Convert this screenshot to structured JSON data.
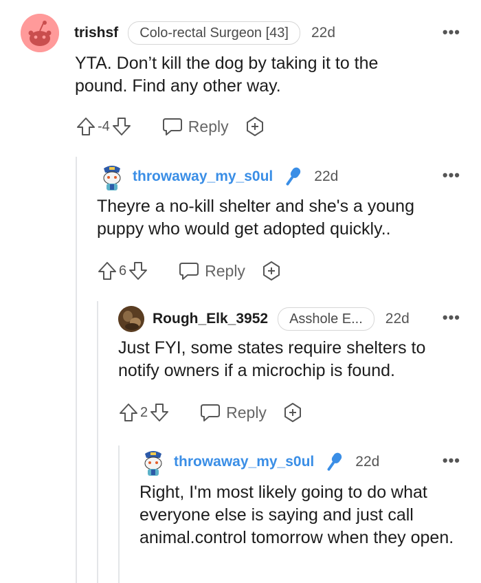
{
  "comments": [
    {
      "author": "trishsf",
      "flair": "Colo-rectal Surgeon [43]",
      "age": "22d",
      "more": "•••",
      "body": "YTA. Don’t kill the dog by taking it to the pound. Find any other way.",
      "score": "-4",
      "reply_label": "Reply",
      "avatar": "snoo-avatar"
    },
    {
      "author": "throwaway_my_s0ul",
      "op_icon": "microphone-icon",
      "age": "22d",
      "more": "•••",
      "body": "Theyre a no-kill shelter and she's a young puppy who would get adopted quickly..",
      "score": "6",
      "reply_label": "Reply",
      "avatar": "police-snoo-avatar"
    },
    {
      "author": "Rough_Elk_3952",
      "flair": "Asshole E...",
      "age": "22d",
      "more": "•••",
      "body": "Just FYI, some states require shelters to notify owners if a microchip is found.",
      "score": "2",
      "reply_label": "Reply",
      "avatar": "photo-avatar"
    },
    {
      "author": "throwaway_my_s0ul",
      "op_icon": "microphone-icon",
      "age": "22d",
      "more": "•••",
      "body": "Right, I'm most likely going to do what everyone else is saying and just call animal.control tomorrow when they open.",
      "avatar": "police-snoo-avatar"
    }
  ],
  "colors": {
    "op_blue": "#3a8ee6",
    "snoo_pink": "#ff9a9a",
    "thread_line": "#e3e5e8"
  }
}
